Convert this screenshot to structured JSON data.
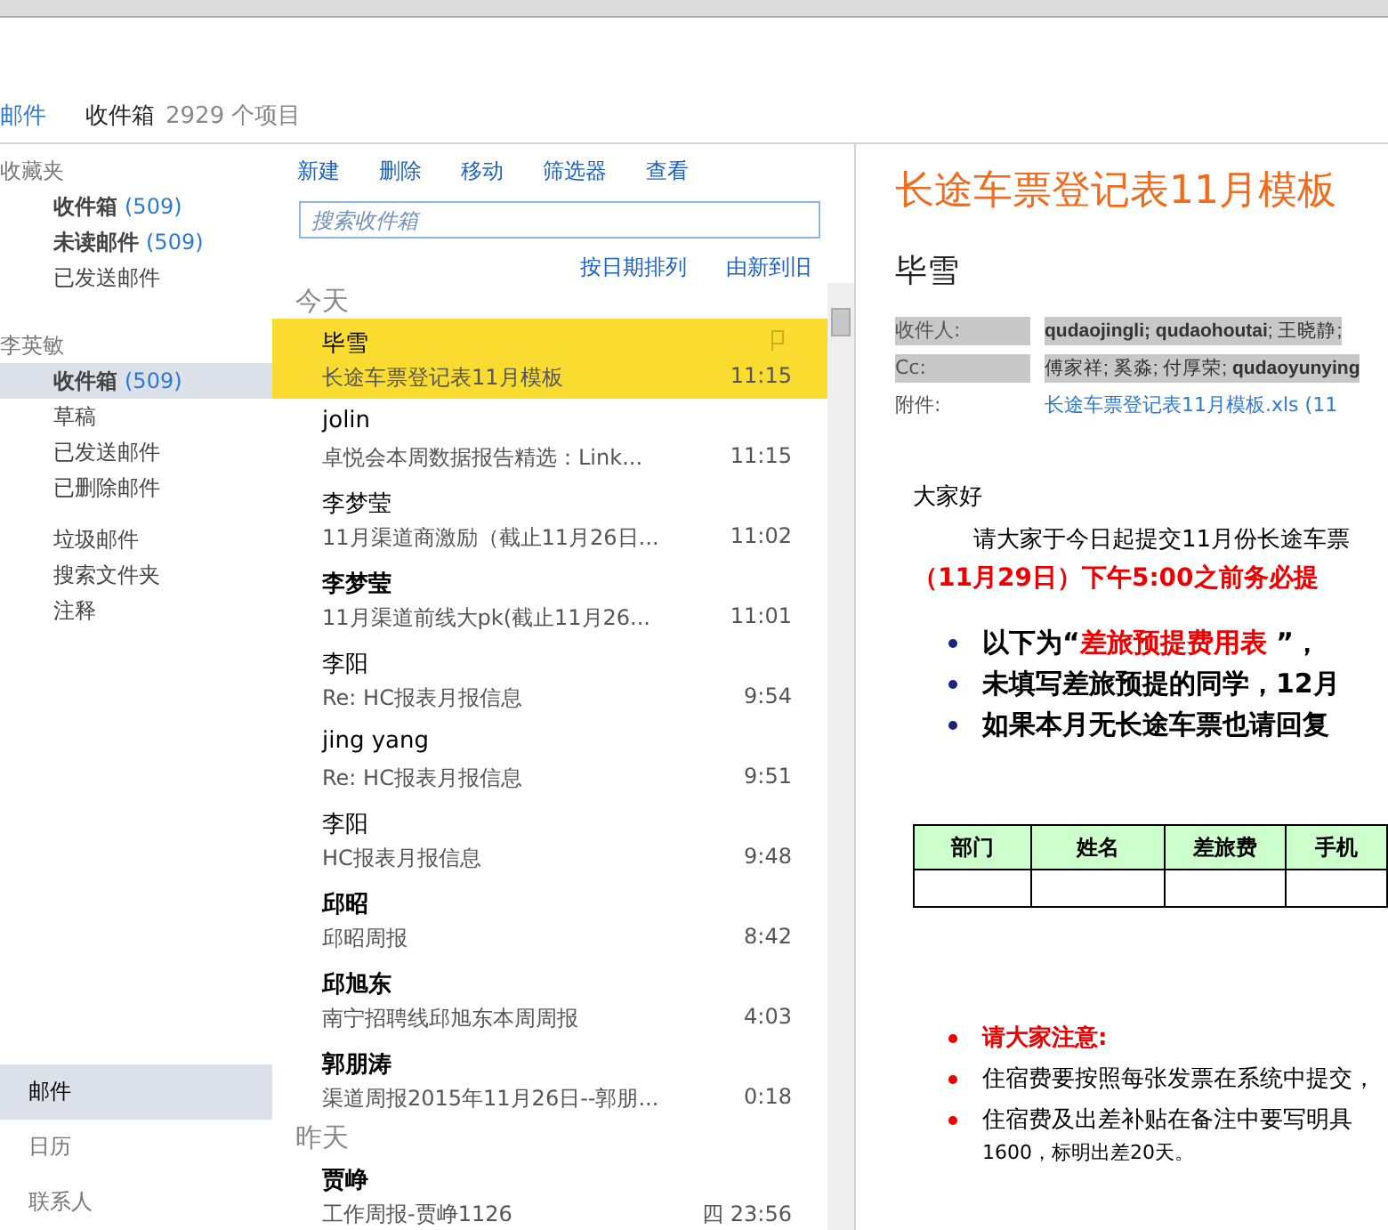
{
  "header": {
    "app": "邮件",
    "folder": "收件箱",
    "count": "2929 个项目"
  },
  "folder_groups": [
    {
      "name": "收藏夹",
      "items": [
        {
          "label": "收件箱",
          "count": "(509)",
          "unread": true,
          "selected": false
        },
        {
          "label": "未读邮件",
          "count": "(509)",
          "unread": true,
          "selected": false
        },
        {
          "label": "已发送邮件",
          "unread": false,
          "selected": false
        }
      ]
    },
    {
      "name": "李英敏",
      "items": [
        {
          "label": "收件箱",
          "count": "(509)",
          "unread": true,
          "selected": true
        },
        {
          "label": "草稿",
          "unread": false,
          "selected": false
        },
        {
          "label": "已发送邮件",
          "unread": false,
          "selected": false
        },
        {
          "label": "已删除邮件",
          "unread": false,
          "selected": false
        }
      ],
      "more_items": [
        {
          "label": "垃圾邮件",
          "unread": false,
          "selected": false
        },
        {
          "label": "搜索文件夹",
          "unread": false,
          "selected": false
        },
        {
          "label": "注释",
          "unread": false,
          "selected": false
        }
      ]
    }
  ],
  "nav": [
    {
      "label": "邮件",
      "selected": true
    },
    {
      "label": "日历",
      "selected": false
    },
    {
      "label": "联系人",
      "selected": false
    }
  ],
  "toolbar": [
    "新建",
    "删除",
    "移动",
    "筛选器",
    "查看"
  ],
  "search": {
    "placeholder": "搜索收件箱"
  },
  "sort": [
    "按日期排列",
    "由新到旧"
  ],
  "message_groups": [
    {
      "heading": "今天",
      "messages": [
        {
          "sender": "毕雪",
          "subject": "长途车票登记表11月模板",
          "time": "11:15",
          "unread": false,
          "selected": true
        },
        {
          "sender": "jolin",
          "subject": "卓悦会本周数据报告精选：Link...",
          "time": "11:15",
          "unread": false,
          "selected": false
        },
        {
          "sender": "李梦莹",
          "subject": "11月渠道商激励（截止11月26日...",
          "time": "11:02",
          "unread": false,
          "selected": false
        },
        {
          "sender": "李梦莹",
          "subject": "11月渠道前线大pk(截止11月26...",
          "time": "11:01",
          "unread": true,
          "selected": false
        },
        {
          "sender": "李阳",
          "subject": "Re: HC报表月报信息",
          "time": "9:54",
          "unread": false,
          "selected": false
        },
        {
          "sender": "jing yang",
          "subject": "Re: HC报表月报信息",
          "time": "9:51",
          "unread": false,
          "selected": false
        },
        {
          "sender": "李阳",
          "subject": "HC报表月报信息",
          "time": "9:48",
          "unread": false,
          "selected": false
        },
        {
          "sender": "邱昭",
          "subject": "邱昭周报",
          "time": "8:42",
          "unread": true,
          "selected": false
        },
        {
          "sender": "邱旭东",
          "subject": "南宁招聘线邱旭东本周周报",
          "time": "4:03",
          "unread": true,
          "selected": false
        },
        {
          "sender": "郭朋涛",
          "subject": "渠道周报2015年11月26日--郭朋...",
          "time": "0:18",
          "unread": true,
          "selected": false
        }
      ]
    },
    {
      "heading": "昨天",
      "messages": [
        {
          "sender": "贾峥",
          "subject": "工作周报-贾峥1126",
          "time": "四 23:56",
          "unread": true,
          "selected": false
        }
      ]
    }
  ],
  "reading": {
    "subject": "长途车票登记表11月模板",
    "sender": "毕雪",
    "fields": [
      {
        "kind": "recipients",
        "label": "收件人:",
        "value": "**qudaojingli; qudaohoutai**; 王晓静;"
      },
      {
        "kind": "recipients",
        "label": "Cc:",
        "value": "傅家祥; 奚淼; 付厚荣; **qudaoyunying**"
      },
      {
        "kind": "attachment",
        "label": "附件:",
        "value": "长途车票登记表11月模板.xls (11"
      }
    ],
    "greeting": "大家好",
    "paragraph": "请大家于今日起提交11月份长途车票",
    "deadline": "（11月29日）下午5:00之前务必提",
    "bullets": [
      [
        {
          "text": "以下为“",
          "emphasis": false
        },
        {
          "text": "差旅预提费用表",
          "emphasis": true
        },
        {
          "text": " ”，",
          "emphasis": false
        }
      ],
      [
        {
          "text": "未填写差旅预提的同学，12月",
          "emphasis": false
        }
      ],
      [
        {
          "text": "如果本月无长途车票也请回复",
          "emphasis": false
        }
      ]
    ],
    "table": {
      "columns": [
        "部门",
        "姓名",
        "差旅费",
        "手机"
      ]
    },
    "notes": [
      {
        "text": "请大家注意:",
        "emphasis": true,
        "continuation": false
      },
      {
        "text": "住宿费要按照每张发票在系统中提交，",
        "emphasis": false,
        "continuation": false
      },
      {
        "text": "住宿费及出差补贴在备注中要写明具",
        "emphasis": false,
        "continuation": false
      },
      {
        "text": "1600，标明出差20天。",
        "emphasis": false,
        "continuation": true
      }
    ]
  }
}
